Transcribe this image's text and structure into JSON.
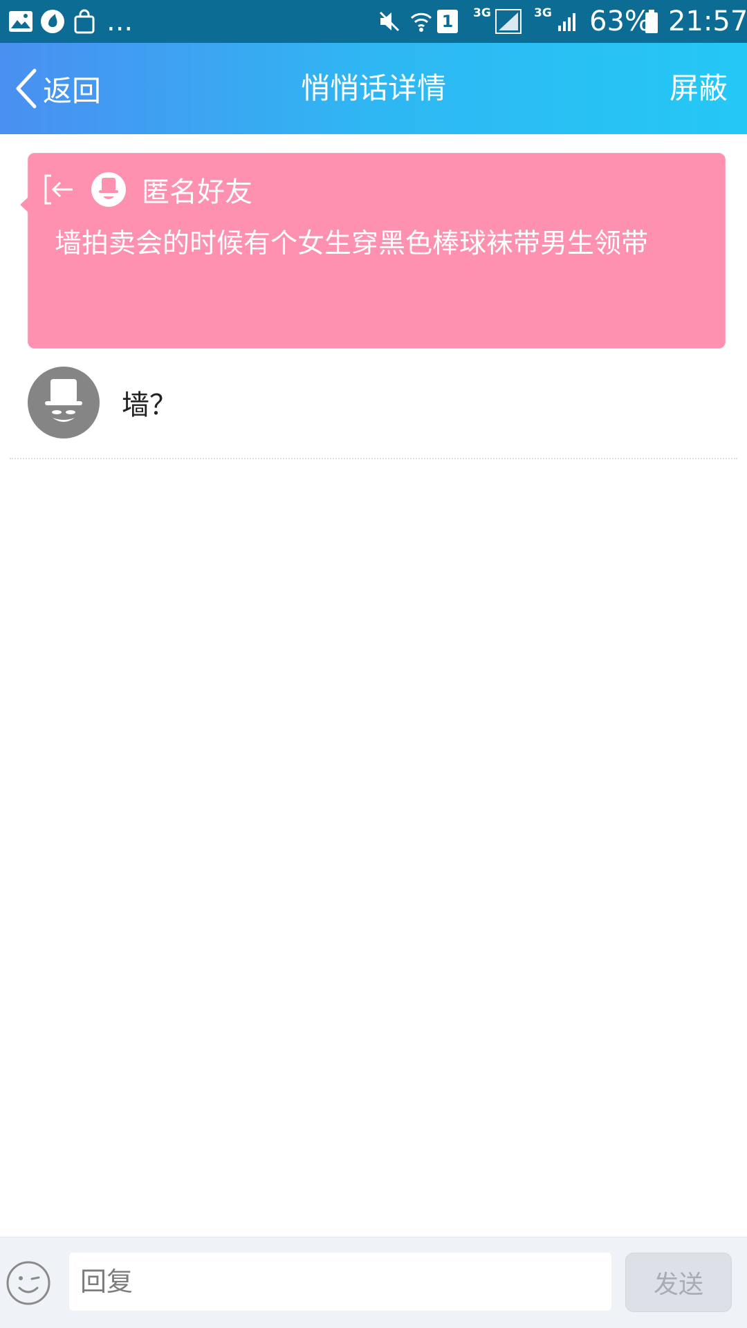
{
  "status_bar": {
    "overflow": "...",
    "network_1": "3G",
    "network_2": "3G",
    "sim_slot": "1",
    "battery": "63%",
    "time": "21:57",
    "icons": [
      "gallery-icon",
      "sync-icon",
      "shopping-bag-icon",
      "mute-icon",
      "wifi-icon",
      "sim-1-icon",
      "signal-icon",
      "signal-icon",
      "battery-icon"
    ]
  },
  "header": {
    "back_label": "返回",
    "title": "悄悄话详情",
    "action_label": "屏蔽"
  },
  "whisper": {
    "sender": "匿名好友",
    "text": "墙拍卖会的时候有个女生穿黑色棒球袜带男生领带",
    "background": "#fe90b0"
  },
  "reply": {
    "text": "墙？"
  },
  "input_bar": {
    "placeholder": "回复",
    "send_label": "发送"
  },
  "colors": {
    "status_bar": "#0d6c93",
    "header_start": "#4a8ff1",
    "header_end": "#24c8f5",
    "send_disabled": "#dde1e7"
  }
}
